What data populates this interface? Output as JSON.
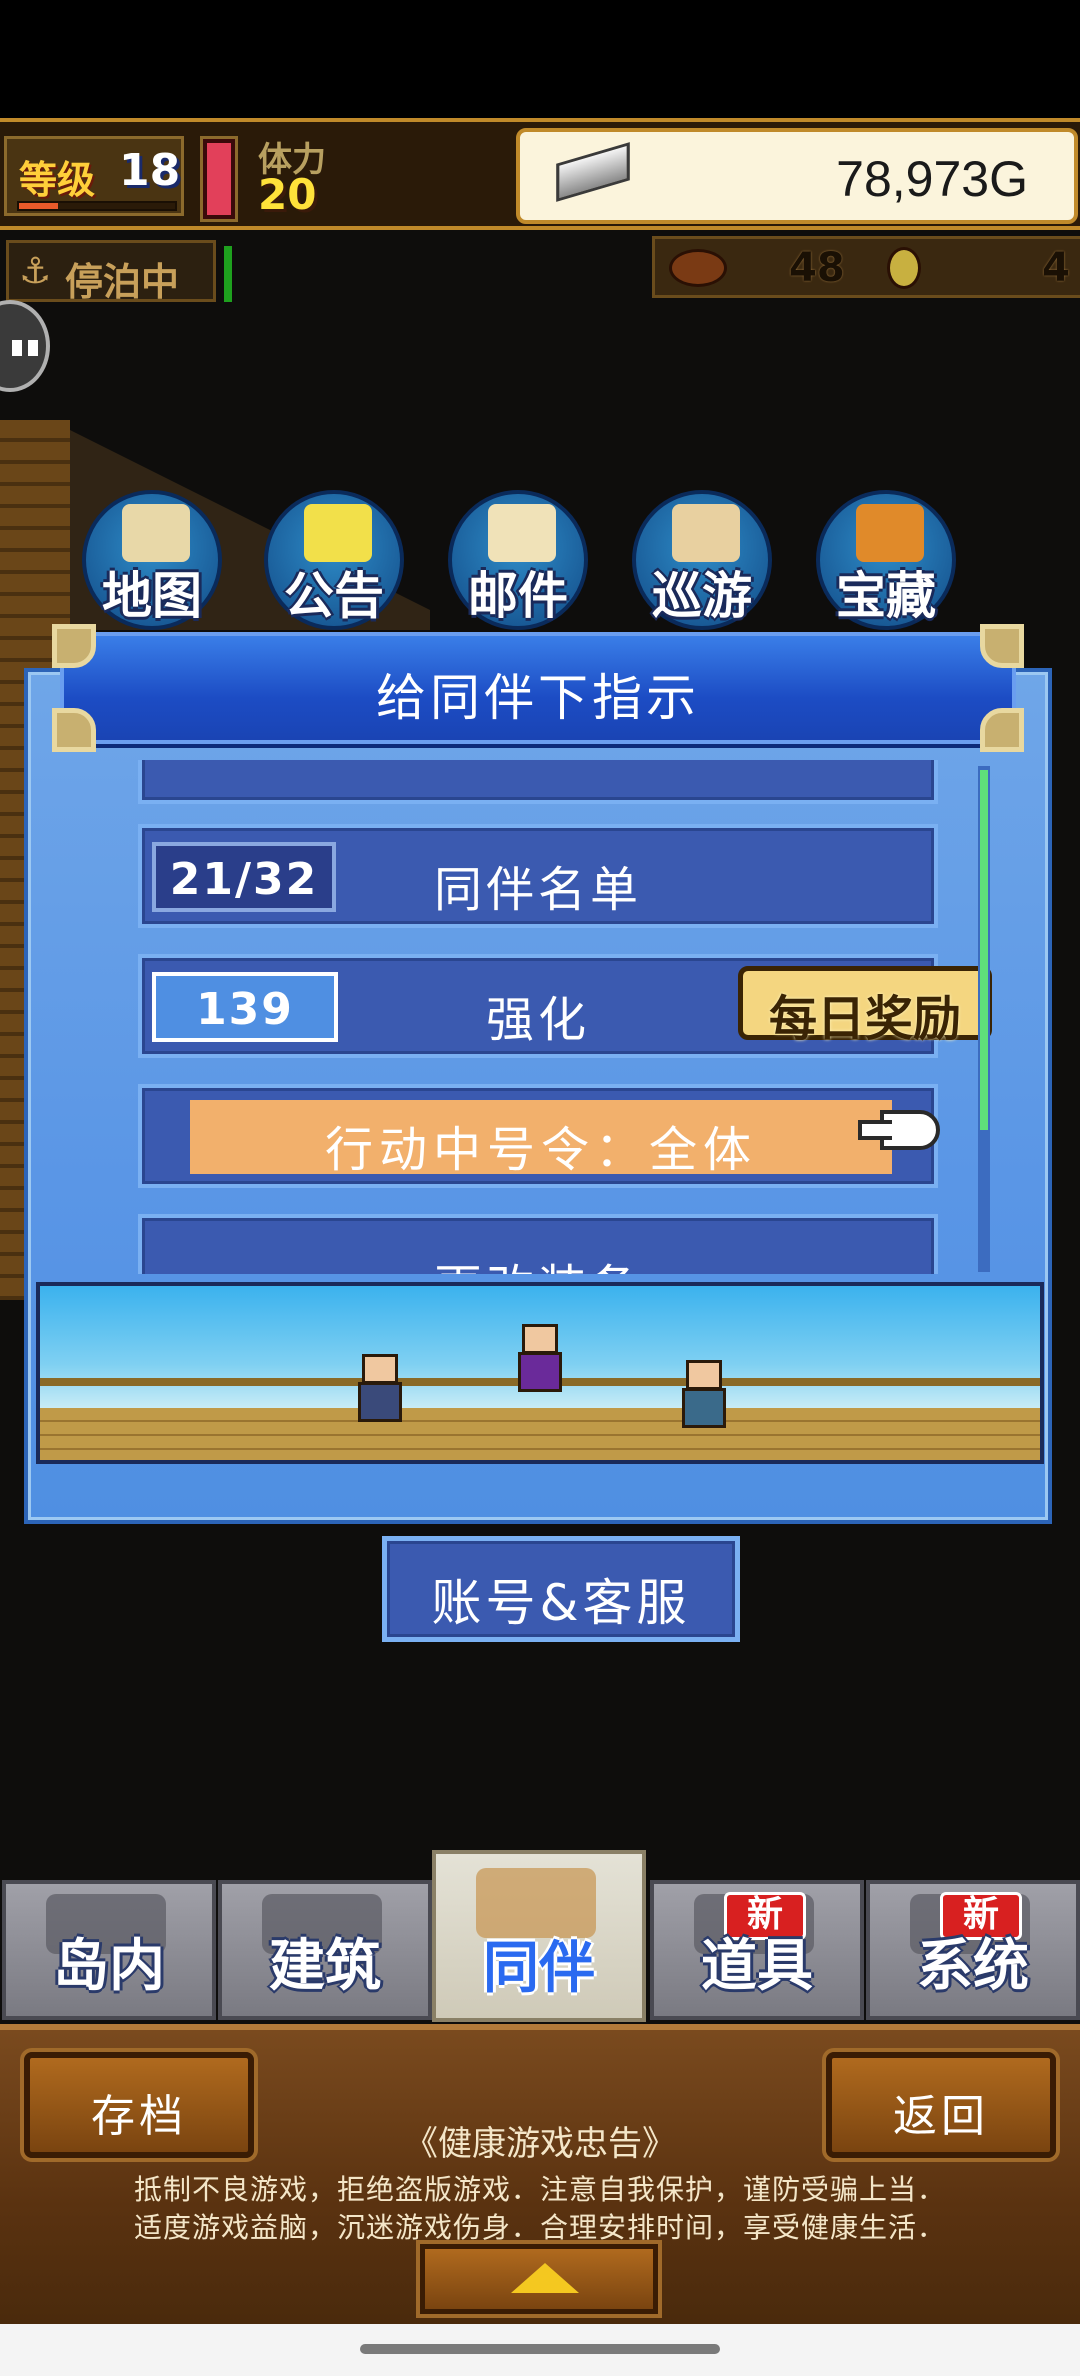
{
  "hud": {
    "level_label": "等级",
    "level": "18",
    "level_progress": 0.25,
    "stamina_label": "体力",
    "stamina": "20",
    "money": "78,973G",
    "docked_label": "停泊中",
    "food": "48",
    "gems": "4"
  },
  "menu": [
    {
      "label": "地图",
      "icon": "map-icon",
      "color": "#e8d8a8"
    },
    {
      "label": "公告",
      "icon": "notice-board-icon",
      "color": "#f2e04a"
    },
    {
      "label": "邮件",
      "icon": "mail-icon",
      "color": "#f0e2b8"
    },
    {
      "label": "巡游",
      "icon": "ship-icon",
      "color": "#e8d0a0"
    },
    {
      "label": "宝藏",
      "icon": "treasure-chest-icon",
      "color": "#e08a2a"
    }
  ],
  "dialog": {
    "title": "给同伴下指示",
    "rows": {
      "roster_label": "同伴名单",
      "roster_count": "21/32",
      "enhance_label": "强化",
      "enhance_count": "139",
      "daily_badge": "每日奖励",
      "order_label": "行动中号令：全体",
      "equip_label": "更改装备"
    }
  },
  "account_button": "账号&客服",
  "tabs": [
    {
      "label": "岛内",
      "icon": "island-icon",
      "active": false,
      "badge": ""
    },
    {
      "label": "建筑",
      "icon": "building-icon",
      "active": false,
      "badge": ""
    },
    {
      "label": "同伴",
      "icon": "companions-icon",
      "active": true,
      "badge": ""
    },
    {
      "label": "道具",
      "icon": "item-icon",
      "active": false,
      "badge": "新"
    },
    {
      "label": "系统",
      "icon": "system-icon",
      "active": false,
      "badge": "新"
    }
  ],
  "bottom": {
    "save_label": "存档",
    "back_label": "返回",
    "notice_title": "《健康游戏忠告》",
    "notice_line1": "抵制不良游戏，拒绝盗版游戏．注意自我保护，谨防受骗上当．",
    "notice_line2": "适度游戏益脑，沉迷游戏伤身．合理安排时间，享受健康生活．"
  },
  "colors": {
    "dialog_blue": "#5a96e6",
    "row_blue": "#3b5ab0",
    "order_orange": "#f2b06c",
    "active_tab_text": "#2a6af0",
    "wood": "#7a4a1e"
  }
}
